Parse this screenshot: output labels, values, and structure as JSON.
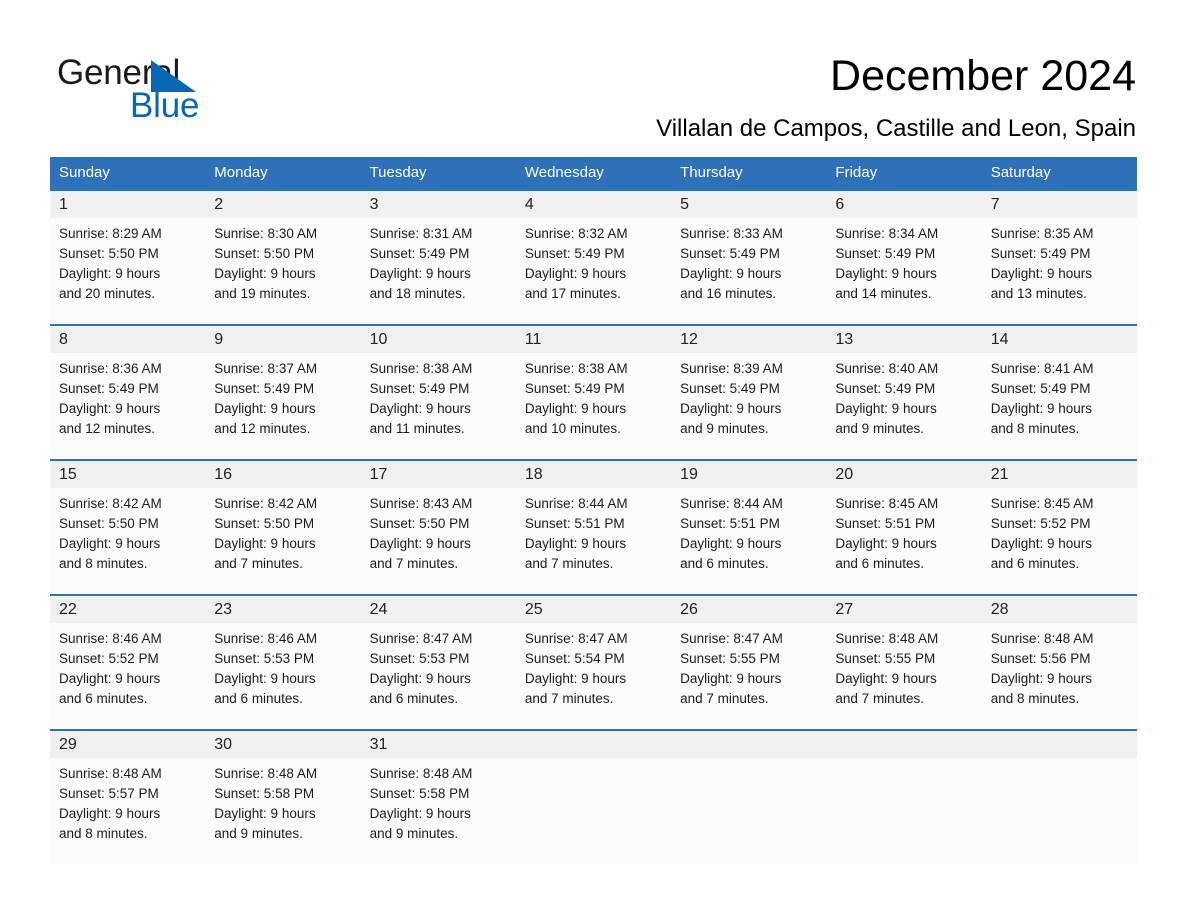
{
  "brand": {
    "name_part1": "General",
    "name_part2": "Blue",
    "accent_color": "#0a67b5",
    "logo_icon": "triangle-logo-icon"
  },
  "header": {
    "title": "December 2024",
    "subtitle": "Villalan de Campos, Castille and Leon, Spain"
  },
  "calendar": {
    "header_bg": "#2e71b8",
    "daynumber_bg": "#f0f0f0",
    "weekdays": [
      "Sunday",
      "Monday",
      "Tuesday",
      "Wednesday",
      "Thursday",
      "Friday",
      "Saturday"
    ],
    "weeks": [
      [
        {
          "day": "1",
          "sunrise": "Sunrise: 8:29 AM",
          "sunset": "Sunset: 5:50 PM",
          "daylight_line1": "Daylight: 9 hours",
          "daylight_line2": "and 20 minutes."
        },
        {
          "day": "2",
          "sunrise": "Sunrise: 8:30 AM",
          "sunset": "Sunset: 5:50 PM",
          "daylight_line1": "Daylight: 9 hours",
          "daylight_line2": "and 19 minutes."
        },
        {
          "day": "3",
          "sunrise": "Sunrise: 8:31 AM",
          "sunset": "Sunset: 5:49 PM",
          "daylight_line1": "Daylight: 9 hours",
          "daylight_line2": "and 18 minutes."
        },
        {
          "day": "4",
          "sunrise": "Sunrise: 8:32 AM",
          "sunset": "Sunset: 5:49 PM",
          "daylight_line1": "Daylight: 9 hours",
          "daylight_line2": "and 17 minutes."
        },
        {
          "day": "5",
          "sunrise": "Sunrise: 8:33 AM",
          "sunset": "Sunset: 5:49 PM",
          "daylight_line1": "Daylight: 9 hours",
          "daylight_line2": "and 16 minutes."
        },
        {
          "day": "6",
          "sunrise": "Sunrise: 8:34 AM",
          "sunset": "Sunset: 5:49 PM",
          "daylight_line1": "Daylight: 9 hours",
          "daylight_line2": "and 14 minutes."
        },
        {
          "day": "7",
          "sunrise": "Sunrise: 8:35 AM",
          "sunset": "Sunset: 5:49 PM",
          "daylight_line1": "Daylight: 9 hours",
          "daylight_line2": "and 13 minutes."
        }
      ],
      [
        {
          "day": "8",
          "sunrise": "Sunrise: 8:36 AM",
          "sunset": "Sunset: 5:49 PM",
          "daylight_line1": "Daylight: 9 hours",
          "daylight_line2": "and 12 minutes."
        },
        {
          "day": "9",
          "sunrise": "Sunrise: 8:37 AM",
          "sunset": "Sunset: 5:49 PM",
          "daylight_line1": "Daylight: 9 hours",
          "daylight_line2": "and 12 minutes."
        },
        {
          "day": "10",
          "sunrise": "Sunrise: 8:38 AM",
          "sunset": "Sunset: 5:49 PM",
          "daylight_line1": "Daylight: 9 hours",
          "daylight_line2": "and 11 minutes."
        },
        {
          "day": "11",
          "sunrise": "Sunrise: 8:38 AM",
          "sunset": "Sunset: 5:49 PM",
          "daylight_line1": "Daylight: 9 hours",
          "daylight_line2": "and 10 minutes."
        },
        {
          "day": "12",
          "sunrise": "Sunrise: 8:39 AM",
          "sunset": "Sunset: 5:49 PM",
          "daylight_line1": "Daylight: 9 hours",
          "daylight_line2": "and 9 minutes."
        },
        {
          "day": "13",
          "sunrise": "Sunrise: 8:40 AM",
          "sunset": "Sunset: 5:49 PM",
          "daylight_line1": "Daylight: 9 hours",
          "daylight_line2": "and 9 minutes."
        },
        {
          "day": "14",
          "sunrise": "Sunrise: 8:41 AM",
          "sunset": "Sunset: 5:49 PM",
          "daylight_line1": "Daylight: 9 hours",
          "daylight_line2": "and 8 minutes."
        }
      ],
      [
        {
          "day": "15",
          "sunrise": "Sunrise: 8:42 AM",
          "sunset": "Sunset: 5:50 PM",
          "daylight_line1": "Daylight: 9 hours",
          "daylight_line2": "and 8 minutes."
        },
        {
          "day": "16",
          "sunrise": "Sunrise: 8:42 AM",
          "sunset": "Sunset: 5:50 PM",
          "daylight_line1": "Daylight: 9 hours",
          "daylight_line2": "and 7 minutes."
        },
        {
          "day": "17",
          "sunrise": "Sunrise: 8:43 AM",
          "sunset": "Sunset: 5:50 PM",
          "daylight_line1": "Daylight: 9 hours",
          "daylight_line2": "and 7 minutes."
        },
        {
          "day": "18",
          "sunrise": "Sunrise: 8:44 AM",
          "sunset": "Sunset: 5:51 PM",
          "daylight_line1": "Daylight: 9 hours",
          "daylight_line2": "and 7 minutes."
        },
        {
          "day": "19",
          "sunrise": "Sunrise: 8:44 AM",
          "sunset": "Sunset: 5:51 PM",
          "daylight_line1": "Daylight: 9 hours",
          "daylight_line2": "and 6 minutes."
        },
        {
          "day": "20",
          "sunrise": "Sunrise: 8:45 AM",
          "sunset": "Sunset: 5:51 PM",
          "daylight_line1": "Daylight: 9 hours",
          "daylight_line2": "and 6 minutes."
        },
        {
          "day": "21",
          "sunrise": "Sunrise: 8:45 AM",
          "sunset": "Sunset: 5:52 PM",
          "daylight_line1": "Daylight: 9 hours",
          "daylight_line2": "and 6 minutes."
        }
      ],
      [
        {
          "day": "22",
          "sunrise": "Sunrise: 8:46 AM",
          "sunset": "Sunset: 5:52 PM",
          "daylight_line1": "Daylight: 9 hours",
          "daylight_line2": "and 6 minutes."
        },
        {
          "day": "23",
          "sunrise": "Sunrise: 8:46 AM",
          "sunset": "Sunset: 5:53 PM",
          "daylight_line1": "Daylight: 9 hours",
          "daylight_line2": "and 6 minutes."
        },
        {
          "day": "24",
          "sunrise": "Sunrise: 8:47 AM",
          "sunset": "Sunset: 5:53 PM",
          "daylight_line1": "Daylight: 9 hours",
          "daylight_line2": "and 6 minutes."
        },
        {
          "day": "25",
          "sunrise": "Sunrise: 8:47 AM",
          "sunset": "Sunset: 5:54 PM",
          "daylight_line1": "Daylight: 9 hours",
          "daylight_line2": "and 7 minutes."
        },
        {
          "day": "26",
          "sunrise": "Sunrise: 8:47 AM",
          "sunset": "Sunset: 5:55 PM",
          "daylight_line1": "Daylight: 9 hours",
          "daylight_line2": "and 7 minutes."
        },
        {
          "day": "27",
          "sunrise": "Sunrise: 8:48 AM",
          "sunset": "Sunset: 5:55 PM",
          "daylight_line1": "Daylight: 9 hours",
          "daylight_line2": "and 7 minutes."
        },
        {
          "day": "28",
          "sunrise": "Sunrise: 8:48 AM",
          "sunset": "Sunset: 5:56 PM",
          "daylight_line1": "Daylight: 9 hours",
          "daylight_line2": "and 8 minutes."
        }
      ],
      [
        {
          "day": "29",
          "sunrise": "Sunrise: 8:48 AM",
          "sunset": "Sunset: 5:57 PM",
          "daylight_line1": "Daylight: 9 hours",
          "daylight_line2": "and 8 minutes."
        },
        {
          "day": "30",
          "sunrise": "Sunrise: 8:48 AM",
          "sunset": "Sunset: 5:58 PM",
          "daylight_line1": "Daylight: 9 hours",
          "daylight_line2": "and 9 minutes."
        },
        {
          "day": "31",
          "sunrise": "Sunrise: 8:48 AM",
          "sunset": "Sunset: 5:58 PM",
          "daylight_line1": "Daylight: 9 hours",
          "daylight_line2": "and 9 minutes."
        },
        {
          "day": "",
          "sunrise": "",
          "sunset": "",
          "daylight_line1": "",
          "daylight_line2": ""
        },
        {
          "day": "",
          "sunrise": "",
          "sunset": "",
          "daylight_line1": "",
          "daylight_line2": ""
        },
        {
          "day": "",
          "sunrise": "",
          "sunset": "",
          "daylight_line1": "",
          "daylight_line2": ""
        },
        {
          "day": "",
          "sunrise": "",
          "sunset": "",
          "daylight_line1": "",
          "daylight_line2": ""
        }
      ]
    ]
  }
}
